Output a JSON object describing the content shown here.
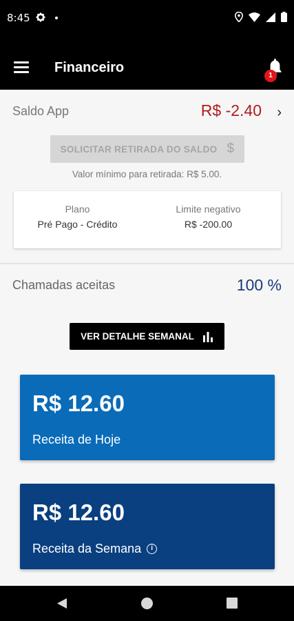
{
  "status_bar": {
    "time": "8:45"
  },
  "app_bar": {
    "title": "Financeiro",
    "notification_count": "1"
  },
  "saldo": {
    "label": "Saldo App",
    "value": "R$ -2.40",
    "value_color": "#b01c1c"
  },
  "withdraw": {
    "button_label": "SOLICITAR RETIRADA DO SALDO",
    "note": "Valor mínimo para retirada: R$ 5.00."
  },
  "plan_card": {
    "plan_label": "Plano",
    "plan_value": "Pré Pago - Crédito",
    "limit_label": "Limite negativo",
    "limit_value": "R$ -200.00"
  },
  "calls": {
    "label": "Chamadas aceitas",
    "value": "100 %"
  },
  "weekly_button": {
    "label": "VER DETALHE SEMANAL"
  },
  "cards": {
    "today": {
      "amount": "R$ 12.60",
      "label": "Receita de Hoje",
      "color": "#0a6bb9"
    },
    "week": {
      "amount": "R$ 12.60",
      "label": "Receita da Semana",
      "color": "#0a3f80"
    }
  },
  "icons": [
    "gear-icon",
    "location-icon",
    "wifi-icon",
    "signal-icon",
    "battery-icon",
    "menu-icon",
    "bell-icon",
    "chevron-right-icon",
    "dollar-icon",
    "bar-chart-icon",
    "info-icon",
    "back-icon",
    "home-icon",
    "recent-apps-icon"
  ]
}
